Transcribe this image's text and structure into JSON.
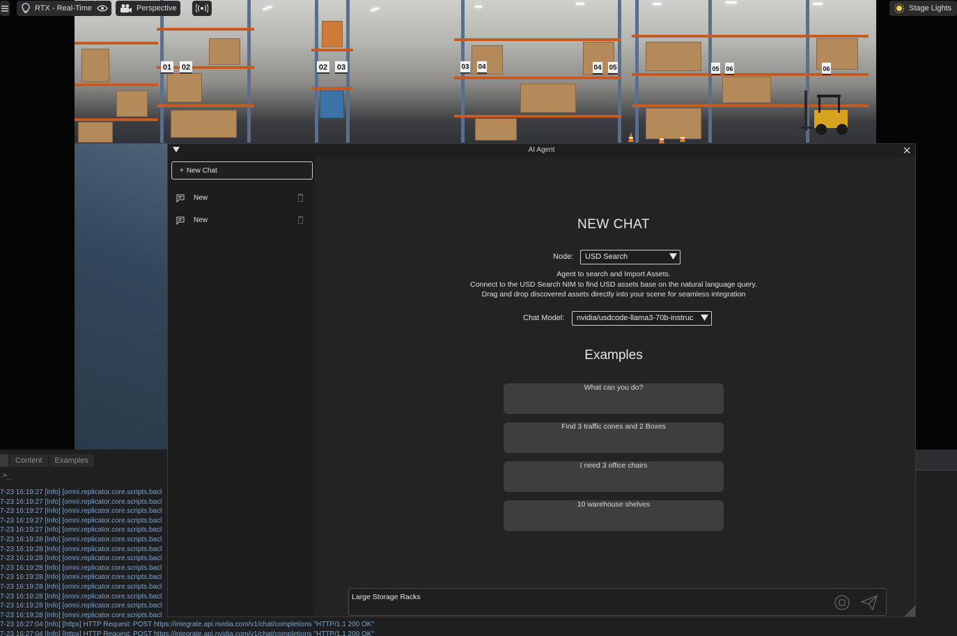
{
  "toolbar": {
    "render_mode": "RTX - Real-Time",
    "camera": "Perspective",
    "stage_lights": "Stage Lights"
  },
  "scene": {
    "bay_labels": [
      "01",
      "02",
      "02",
      "03",
      "03",
      "04",
      "04",
      "05",
      "05",
      "06",
      "06"
    ]
  },
  "console": {
    "tabs": [
      "Content",
      "Examples"
    ],
    "prompt": ">_",
    "log_lines": [
      "7-23 16:19:27  [Info] [omni.replicator.core.scripts.bacl",
      "7-23 16:19:27  [Info] [omni.replicator.core.scripts.bacl",
      "7-23 16:19:27  [Info] [omni.replicator.core.scripts.bacl",
      "7-23 16:19:27  [Info] [omni.replicator.core.scripts.bacl",
      "7-23 16:19:27  [Info] [omni.replicator.core.scripts.bacl",
      "7-23 16:19:28  [Info] [omni.replicator.core.scripts.bacl",
      "7-23 16:19:28  [Info] [omni.replicator.core.scripts.bacl",
      "7-23 16:19:28  [Info] [omni.replicator.core.scripts.bacl",
      "7-23 16:19:28  [Info] [omni.replicator.core.scripts.bacl",
      "7-23 16:19:28  [Info] [omni.replicator.core.scripts.bacl",
      "7-23 16:19:28  [Info] [omni.replicator.core.scripts.bacl",
      "7-23 16:19:28  [Info] [omni.replicator.core.scripts.bacl",
      "7-23 16:19:28  [Info] [omni.replicator.core.scripts.bacl",
      "7-23 16:19:28  [Info] [omni.replicator.core.scripts.bacl",
      "7-23 16:27:04  [Info] [httpx] HTTP Request: POST https://integrate.api.nvidia.com/v1/chat/completions \"HTTP/1.1 200 OK\"",
      "7-23 16:27:04  [Info] [httpx] HTTP Request: POST https://integrate.api.nvidia.com/v1/chat/completions \"HTTP/1.1 200 OK\""
    ]
  },
  "agent": {
    "title": "AI Agent",
    "new_chat_label": "New Chat",
    "chats": [
      {
        "label": "New"
      },
      {
        "label": "New"
      }
    ],
    "heading": "NEW CHAT",
    "node_label": "Node:",
    "node_value": "USD Search",
    "description": [
      "Agent to search and Import Assets.",
      "Connect to the USD Search NIM to find USD assets base on the natural language query.",
      "Drag and drop discovered assets directly into your scene for seamless integration"
    ],
    "model_label": "Chat Model:",
    "model_value": "nvidia/usdcode-llama3-70b-instruc",
    "examples_heading": "Examples",
    "examples": [
      "What can you do?",
      "Find 3 traffic cones and 2 Boxes",
      "I need 3 office chairs",
      "10 warehouse shelves"
    ],
    "input_value": "Large Storage Racks"
  }
}
